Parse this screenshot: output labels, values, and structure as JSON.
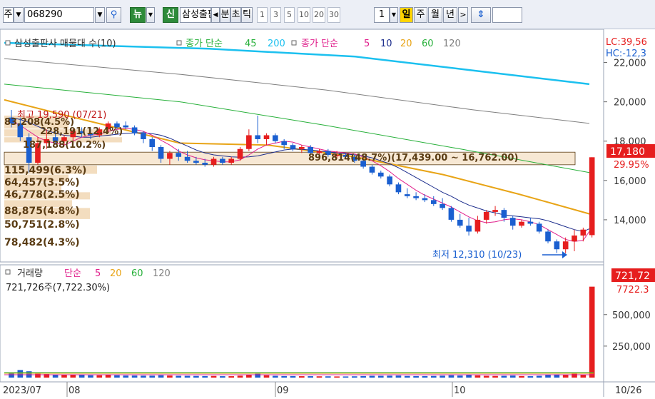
{
  "toolbar": {
    "market": "주",
    "code": "068290",
    "news_label": "뉴",
    "credit_label": "신",
    "name": "삼성출판사",
    "items": [
      "분",
      "초",
      "틱"
    ],
    "periods": [
      "1",
      "3",
      "5",
      "10",
      "20",
      "30"
    ],
    "count": "1",
    "cycles": [
      "일",
      "주",
      "월",
      "년"
    ]
  },
  "price_panel": {
    "legend": {
      "title": "삼성출판사 매물대 수(10)",
      "ma_long_label": "종가 단순",
      "ma_long": [
        "45",
        "200"
      ],
      "ma_short_label": "종가 단순",
      "ma_short": [
        "5",
        "10",
        "20",
        "60",
        "120"
      ]
    },
    "high_label": "최고 19,590 (07/21)",
    "low_label": "최저 12,310 (10/23)",
    "current_band_label": "896,814(48.7%)(17,439.00 ~ 16,762.00)",
    "volume_profile_labels": [
      "83,208(4.5%)",
      "228,191(12.4%)",
      "187,188(10.2%)",
      "115,499(6.3%)",
      "64,457(3.5%)",
      "46,778(2.5%)",
      "88,875(4.8%)",
      "50,751(2.8%)",
      "78,482(4.3%)"
    ],
    "lc_label": "LC:39,56",
    "hc_label": "HC:-12,3",
    "price_box": "17,180",
    "change_box": "29.95%",
    "y_ticks": [
      "22,000",
      "20,000",
      "18,000",
      "16,000",
      "14,000"
    ]
  },
  "volume_panel": {
    "legend_title": "거래량",
    "ma_label": "단순",
    "periods": [
      "5",
      "20",
      "60",
      "120"
    ],
    "summary": "721,726주(7,722.30%)",
    "volume_box": "721,72",
    "ratio_box": "7722.3",
    "y_ticks": [
      "500,000",
      "250,000"
    ]
  },
  "x_ticks": [
    "2023/07",
    "08",
    "09",
    "10",
    "10/26"
  ],
  "chart_data": {
    "type": "candlestick",
    "symbol": "068290",
    "period": "daily",
    "ylim": [
      12000,
      23400
    ],
    "volume_ylim": [
      0,
      850000
    ],
    "colors": {
      "up": "#e61e1e",
      "down": "#1a5fd0",
      "ma5": "#e0208c",
      "ma10": "#1c2d8c",
      "ma20": "#e8a416",
      "ma60": "#27b03a",
      "ma120": "#7f7f7f",
      "ma200": "#1bc0ef",
      "profile": "#f2d9b8"
    },
    "candles": [
      {
        "o": 19200,
        "h": 19590,
        "l": 18700,
        "c": 18900,
        "v": 40000
      },
      {
        "o": 18900,
        "h": 19200,
        "l": 18000,
        "c": 18200,
        "v": 60000
      },
      {
        "o": 18200,
        "h": 18400,
        "l": 16400,
        "c": 16900,
        "v": 50000
      },
      {
        "o": 16900,
        "h": 18200,
        "l": 16800,
        "c": 17900,
        "v": 30000
      },
      {
        "o": 17900,
        "h": 18600,
        "l": 17600,
        "c": 18100,
        "v": 28000
      },
      {
        "o": 18200,
        "h": 18600,
        "l": 17900,
        "c": 18000,
        "v": 24000
      },
      {
        "o": 18000,
        "h": 18300,
        "l": 17800,
        "c": 18200,
        "v": 22000
      },
      {
        "o": 18200,
        "h": 18600,
        "l": 18000,
        "c": 18500,
        "v": 24000
      },
      {
        "o": 18500,
        "h": 18700,
        "l": 18200,
        "c": 18400,
        "v": 20000
      },
      {
        "o": 18400,
        "h": 18700,
        "l": 18100,
        "c": 18300,
        "v": 18000
      },
      {
        "o": 18300,
        "h": 18700,
        "l": 18200,
        "c": 18600,
        "v": 18000
      },
      {
        "o": 18600,
        "h": 19000,
        "l": 18500,
        "c": 18900,
        "v": 22000
      },
      {
        "o": 18900,
        "h": 19000,
        "l": 18600,
        "c": 18700,
        "v": 18000
      },
      {
        "o": 18800,
        "h": 19000,
        "l": 18600,
        "c": 18700,
        "v": 16000
      },
      {
        "o": 18700,
        "h": 18800,
        "l": 18300,
        "c": 18400,
        "v": 16000
      },
      {
        "o": 18400,
        "h": 18500,
        "l": 17900,
        "c": 18100,
        "v": 15000
      },
      {
        "o": 18100,
        "h": 18200,
        "l": 17500,
        "c": 17700,
        "v": 15000
      },
      {
        "o": 17700,
        "h": 17800,
        "l": 16900,
        "c": 17100,
        "v": 18000
      },
      {
        "o": 17100,
        "h": 17500,
        "l": 16800,
        "c": 17400,
        "v": 16000
      },
      {
        "o": 17400,
        "h": 17600,
        "l": 17000,
        "c": 17200,
        "v": 14000
      },
      {
        "o": 17200,
        "h": 17500,
        "l": 16900,
        "c": 17000,
        "v": 14000
      },
      {
        "o": 17000,
        "h": 17200,
        "l": 16800,
        "c": 16900,
        "v": 13000
      },
      {
        "o": 16900,
        "h": 17100,
        "l": 16700,
        "c": 16800,
        "v": 12000
      },
      {
        "o": 16800,
        "h": 17200,
        "l": 16700,
        "c": 17100,
        "v": 13000
      },
      {
        "o": 17100,
        "h": 17200,
        "l": 16800,
        "c": 16900,
        "v": 11000
      },
      {
        "o": 16900,
        "h": 17200,
        "l": 16800,
        "c": 17100,
        "v": 11000
      },
      {
        "o": 17100,
        "h": 17700,
        "l": 17000,
        "c": 17600,
        "v": 15000
      },
      {
        "o": 17600,
        "h": 18600,
        "l": 17500,
        "c": 18300,
        "v": 25000
      },
      {
        "o": 18300,
        "h": 19300,
        "l": 17900,
        "c": 18100,
        "v": 30000
      },
      {
        "o": 18100,
        "h": 18400,
        "l": 17800,
        "c": 18300,
        "v": 18000
      },
      {
        "o": 18300,
        "h": 18400,
        "l": 17900,
        "c": 18000,
        "v": 14000
      },
      {
        "o": 18000,
        "h": 18100,
        "l": 17600,
        "c": 17800,
        "v": 12000
      },
      {
        "o": 17800,
        "h": 17900,
        "l": 17500,
        "c": 17600,
        "v": 12000
      },
      {
        "o": 17600,
        "h": 17800,
        "l": 17400,
        "c": 17700,
        "v": 11000
      },
      {
        "o": 17700,
        "h": 17800,
        "l": 17300,
        "c": 17400,
        "v": 11000
      },
      {
        "o": 17400,
        "h": 17600,
        "l": 17200,
        "c": 17500,
        "v": 10000
      },
      {
        "o": 17500,
        "h": 17600,
        "l": 17200,
        "c": 17300,
        "v": 10000
      },
      {
        "o": 17300,
        "h": 17500,
        "l": 17100,
        "c": 17300,
        "v": 9000
      },
      {
        "o": 17300,
        "h": 17400,
        "l": 17100,
        "c": 17200,
        "v": 9000
      },
      {
        "o": 17200,
        "h": 17300,
        "l": 16900,
        "c": 17000,
        "v": 10000
      },
      {
        "o": 17000,
        "h": 17100,
        "l": 16600,
        "c": 16700,
        "v": 12000
      },
      {
        "o": 16700,
        "h": 16800,
        "l": 16300,
        "c": 16400,
        "v": 14000
      },
      {
        "o": 16400,
        "h": 16500,
        "l": 16100,
        "c": 16200,
        "v": 14000
      },
      {
        "o": 16200,
        "h": 16300,
        "l": 15700,
        "c": 15800,
        "v": 15000
      },
      {
        "o": 15800,
        "h": 15900,
        "l": 15300,
        "c": 15400,
        "v": 16000
      },
      {
        "o": 15300,
        "h": 15600,
        "l": 15100,
        "c": 15200,
        "v": 13000
      },
      {
        "o": 15200,
        "h": 15400,
        "l": 15000,
        "c": 15100,
        "v": 12000
      },
      {
        "o": 15100,
        "h": 15300,
        "l": 14900,
        "c": 15000,
        "v": 12000
      },
      {
        "o": 15000,
        "h": 15200,
        "l": 14700,
        "c": 14800,
        "v": 13000
      },
      {
        "o": 14800,
        "h": 15100,
        "l": 14500,
        "c": 14600,
        "v": 15000
      },
      {
        "o": 14600,
        "h": 14700,
        "l": 13900,
        "c": 14000,
        "v": 18000
      },
      {
        "o": 14000,
        "h": 14300,
        "l": 13600,
        "c": 13700,
        "v": 16000
      },
      {
        "o": 13700,
        "h": 14100,
        "l": 13200,
        "c": 13400,
        "v": 22000
      },
      {
        "o": 13400,
        "h": 14200,
        "l": 13300,
        "c": 14000,
        "v": 17000
      },
      {
        "o": 14000,
        "h": 14500,
        "l": 13800,
        "c": 14400,
        "v": 14000
      },
      {
        "o": 14400,
        "h": 14700,
        "l": 14200,
        "c": 14500,
        "v": 13000
      },
      {
        "o": 14500,
        "h": 14600,
        "l": 13900,
        "c": 14100,
        "v": 14000
      },
      {
        "o": 14100,
        "h": 14200,
        "l": 13500,
        "c": 13700,
        "v": 16000
      },
      {
        "o": 13700,
        "h": 14000,
        "l": 13600,
        "c": 13900,
        "v": 12000
      },
      {
        "o": 13900,
        "h": 14100,
        "l": 13700,
        "c": 13800,
        "v": 11000
      },
      {
        "o": 13800,
        "h": 13900,
        "l": 13300,
        "c": 13400,
        "v": 14000
      },
      {
        "o": 13400,
        "h": 13500,
        "l": 12800,
        "c": 12900,
        "v": 20000
      },
      {
        "o": 12900,
        "h": 13000,
        "l": 12310,
        "c": 12500,
        "v": 26000
      },
      {
        "o": 12500,
        "h": 13100,
        "l": 12300,
        "c": 12900,
        "v": 22000
      },
      {
        "o": 12900,
        "h": 13500,
        "l": 12400,
        "c": 13200,
        "v": 30000
      },
      {
        "o": 13200,
        "h": 13600,
        "l": 12900,
        "c": 13500,
        "v": 20000
      },
      {
        "o": 13220,
        "h": 17180,
        "l": 13100,
        "c": 17180,
        "v": 721726
      }
    ],
    "ma5": [
      19000,
      18800,
      18500,
      18200,
      18000,
      17900,
      17800,
      18000,
      18200,
      18300,
      18350,
      18500,
      18600,
      18650,
      18600,
      18500,
      18300,
      18050,
      17800,
      17500,
      17300,
      17150,
      17050,
      17000,
      16950,
      16950,
      17050,
      17300,
      17600,
      17800,
      17900,
      18000,
      17950,
      17800,
      17700,
      17600,
      17500,
      17450,
      17400,
      17350,
      17200,
      17000,
      16750,
      16450,
      16100,
      15800,
      15500,
      15250,
      15050,
      14850,
      14650,
      14400,
      14150,
      13950,
      13850,
      13900,
      14000,
      14050,
      14000,
      13900,
      13750,
      13500,
      13250,
      13000,
      12900,
      12950,
      13600
    ],
    "ma10": [
      19200,
      19100,
      18950,
      18750,
      18550,
      18400,
      18300,
      18250,
      18200,
      18200,
      18250,
      18300,
      18350,
      18400,
      18420,
      18430,
      18380,
      18300,
      18150,
      17950,
      17750,
      17550,
      17400,
      17300,
      17250,
      17200,
      17180,
      17200,
      17250,
      17350,
      17450,
      17550,
      17600,
      17580,
      17550,
      17500,
      17450,
      17400,
      17350,
      17300,
      17250,
      17150,
      17000,
      16850,
      16650,
      16400,
      16150,
      15900,
      15650,
      15400,
      15200,
      14950,
      14750,
      14600,
      14450,
      14350,
      14250,
      14200,
      14150,
      14100,
      14050,
      13950,
      13800,
      13650,
      13500,
      13400,
      13600
    ]
  }
}
